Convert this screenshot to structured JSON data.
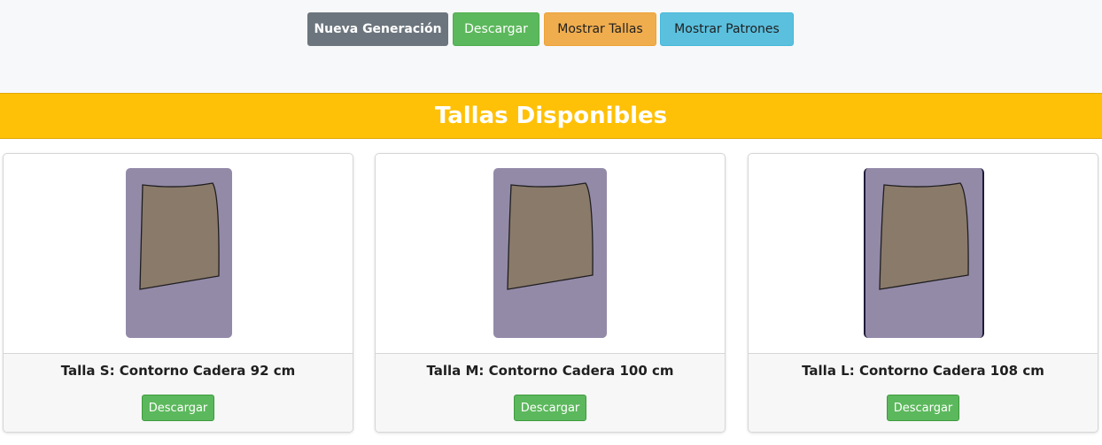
{
  "toolbar": {
    "new_generation": "Nueva Generación",
    "download": "Descargar",
    "show_sizes": "Mostrar Tallas",
    "show_patterns": "Mostrar Patrones"
  },
  "banner": {
    "title": "Tallas Disponibles"
  },
  "sizes": [
    {
      "label": "Talla S: Contorno Cadera 92 cm",
      "download": "Descargar"
    },
    {
      "label": "Talla M: Contorno Cadera 100 cm",
      "download": "Descargar"
    },
    {
      "label": "Talla L: Contorno Cadera 108 cm",
      "download": "Descargar"
    }
  ],
  "colors": {
    "banner": "#ffc107",
    "gray_button": "#6c757d",
    "green_button": "#5cb85c",
    "orange_button": "#f0ad4e",
    "cyan_button": "#5bc0de",
    "pattern_background": "#938aa8",
    "pattern_piece": "#8a7a6a"
  }
}
